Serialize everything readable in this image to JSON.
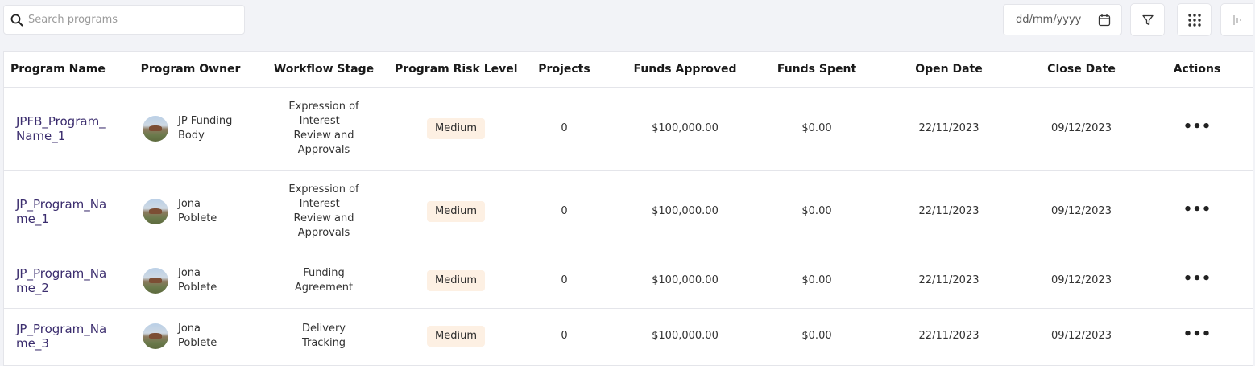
{
  "search": {
    "placeholder": "Search programs",
    "icon": "search-icon"
  },
  "date_filter": {
    "placeholder": "dd/mm/yyyy",
    "icon": "calendar-icon"
  },
  "toolbar_buttons": [
    "filter-icon",
    "grid-icon",
    "columns-icon"
  ],
  "table": {
    "headers": {
      "program_name": "Program Name",
      "program_owner": "Program Owner",
      "workflow_stage": "Workflow Stage",
      "risk_level": "Program Risk Level",
      "projects": "Projects",
      "funds_approved": "Funds Approved",
      "funds_spent": "Funds Spent",
      "open_date": "Open Date",
      "close_date": "Close Date",
      "actions": "Actions"
    },
    "rows": [
      {
        "name_line1": "JPFB_Program_",
        "name_line2": "Name_1",
        "owner_line1": "JP Funding",
        "owner_line2": "Body",
        "stage": [
          "Expression of",
          "Interest –",
          "Review and",
          "Approvals"
        ],
        "risk": "Medium",
        "projects": "0",
        "funds_approved": "$100,000.00",
        "funds_spent": "$0.00",
        "open_date": "22/11/2023",
        "close_date": "09/12/2023",
        "actions": "•••"
      },
      {
        "name_line1": "JP_Program_Na",
        "name_line2": "me_1",
        "owner_line1": "Jona",
        "owner_line2": "Poblete",
        "stage": [
          "Expression of",
          "Interest –",
          "Review and",
          "Approvals"
        ],
        "risk": "Medium",
        "projects": "0",
        "funds_approved": "$100,000.00",
        "funds_spent": "$0.00",
        "open_date": "22/11/2023",
        "close_date": "09/12/2023",
        "actions": "•••"
      },
      {
        "name_line1": "JP_Program_Na",
        "name_line2": "me_2",
        "owner_line1": "Jona",
        "owner_line2": "Poblete",
        "stage": [
          "Funding",
          "Agreement"
        ],
        "risk": "Medium",
        "projects": "0",
        "funds_approved": "$100,000.00",
        "funds_spent": "$0.00",
        "open_date": "22/11/2023",
        "close_date": "09/12/2023",
        "actions": "•••"
      },
      {
        "name_line1": "JP_Program_Na",
        "name_line2": "me_3",
        "owner_line1": "Jona",
        "owner_line2": "Poblete",
        "stage": [
          "Delivery",
          "Tracking"
        ],
        "risk": "Medium",
        "projects": "0",
        "funds_approved": "$100,000.00",
        "funds_spent": "$0.00",
        "open_date": "22/11/2023",
        "close_date": "09/12/2023",
        "actions": "•••"
      }
    ]
  },
  "colors": {
    "page_bg": "#f2f3f7",
    "program_link": "#3b2d6e",
    "badge_bg": "#fdf0e3",
    "border": "#e4e5ea"
  }
}
